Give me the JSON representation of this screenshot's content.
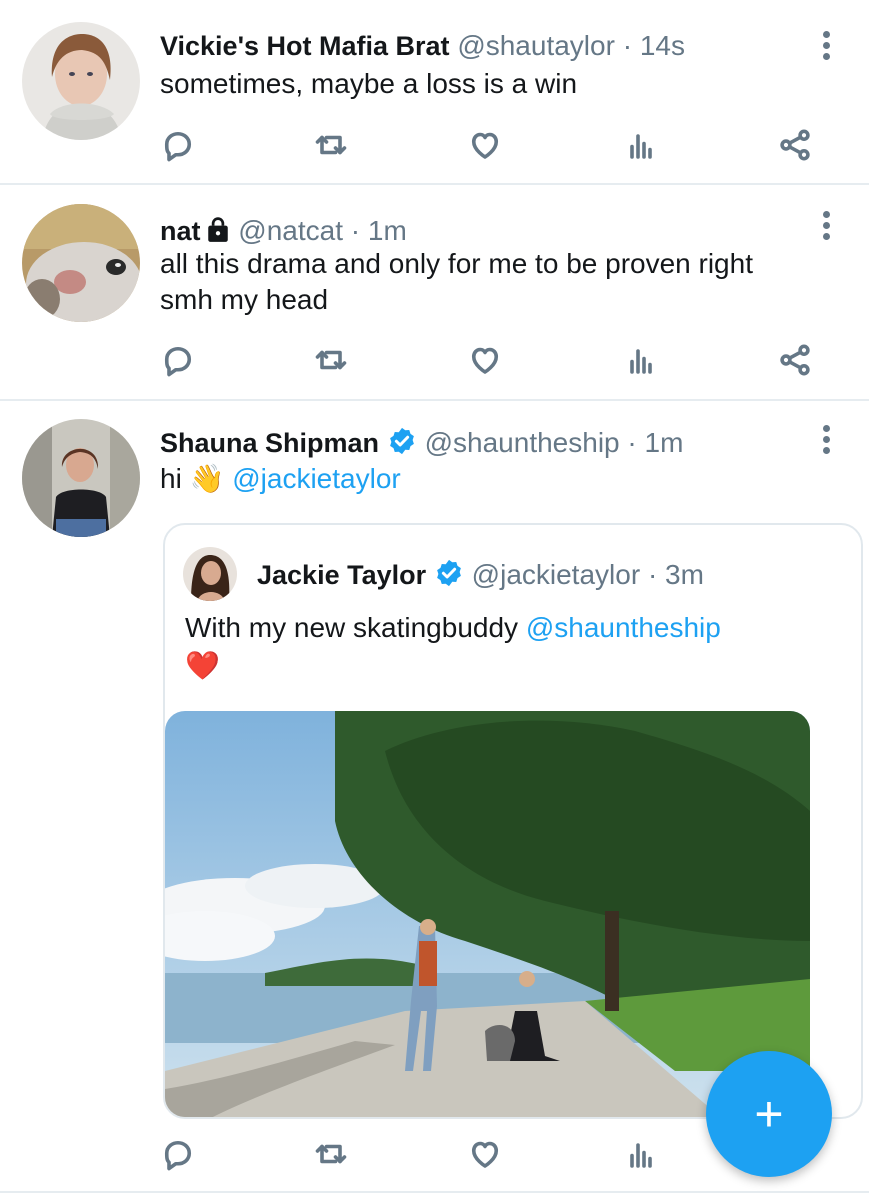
{
  "tweets": [
    {
      "name": "Vickie's Hot Mafia Brat",
      "handle": "@shautaylor",
      "sep": "·",
      "time": "14s",
      "text": "sometimes, maybe a loss is a win"
    },
    {
      "name": "nat",
      "handle": "@natcat",
      "sep": "·",
      "time": "1m",
      "text_line1": "all this drama and only for me to be proven right",
      "text_line2": "smh my head"
    },
    {
      "name": "Shauna Shipman",
      "handle": "@shauntheship",
      "sep": "·",
      "time": "1m",
      "text_prefix": "hi",
      "emoji": "👋",
      "mention": "@jackietaylor",
      "quote": {
        "name": "Jackie Taylor",
        "handle": "@jackietaylor",
        "sep": "·",
        "time": "3m",
        "text_prefix": "With my new skatingbuddy",
        "mention": "@shauntheship",
        "emoji": "❤️"
      }
    }
  ],
  "icons": [
    "reply-icon",
    "retweet-icon",
    "like-icon",
    "analytics-icon",
    "share-icon",
    "more-icon",
    "verified-icon",
    "lock-icon",
    "compose-icon"
  ],
  "fab": {
    "label": "+"
  },
  "colors": {
    "accent": "#1da1f2",
    "text": "#14171a",
    "muted": "#657786",
    "divider": "#e6ecf0"
  }
}
